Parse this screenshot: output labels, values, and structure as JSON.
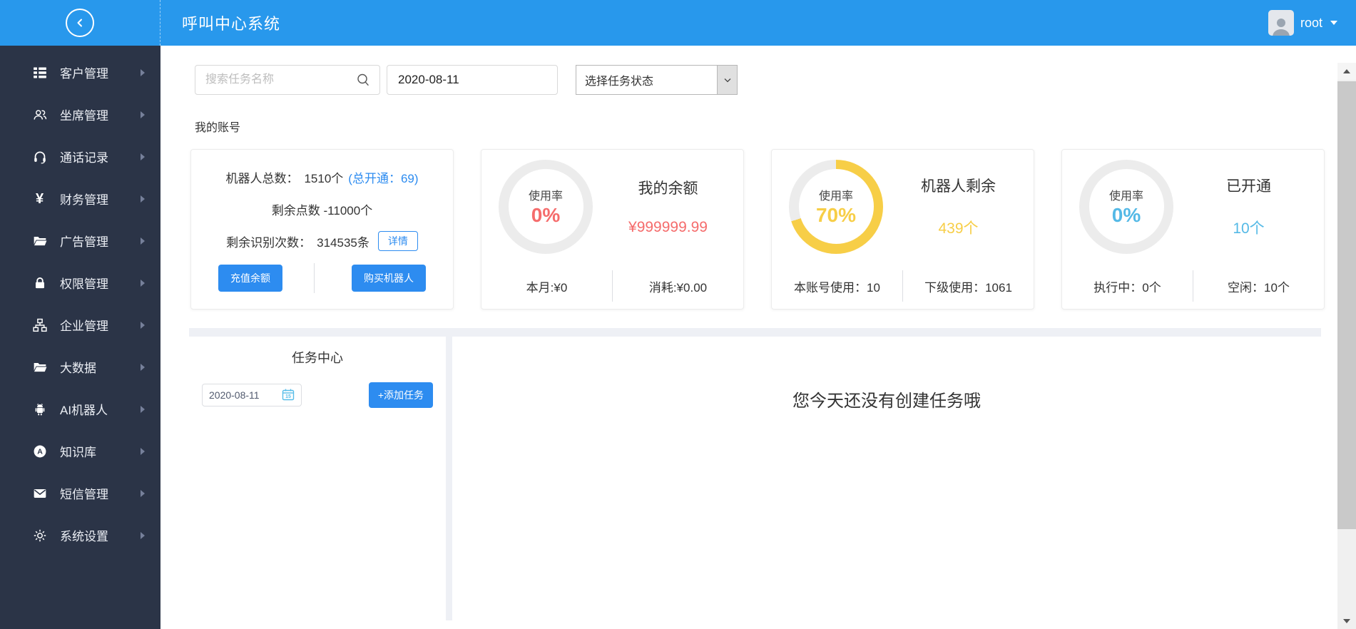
{
  "header": {
    "title": "呼叫中心系统",
    "username": "root",
    "back_icon": "chevron-left-circle-icon",
    "user_caret_icon": "caret-down-icon"
  },
  "sidebar": {
    "items": [
      {
        "label": "客户管理",
        "icon": "menu-grid-icon"
      },
      {
        "label": "坐席管理",
        "icon": "users-icon"
      },
      {
        "label": "通话记录",
        "icon": "headset-icon"
      },
      {
        "label": "财务管理",
        "icon": "yen-icon"
      },
      {
        "label": "广告管理",
        "icon": "folder-icon"
      },
      {
        "label": "权限管理",
        "icon": "lock-icon"
      },
      {
        "label": "企业管理",
        "icon": "sitemap-icon"
      },
      {
        "label": "大数据",
        "icon": "folder-icon"
      },
      {
        "label": "AI机器人",
        "icon": "robot-icon"
      },
      {
        "label": "知识库",
        "icon": "knowledge-circle-a-icon"
      },
      {
        "label": "短信管理",
        "icon": "mail-icon"
      },
      {
        "label": "系统设置",
        "icon": "gear-icon"
      }
    ]
  },
  "filters": {
    "search_placeholder": "搜索任务名称",
    "search_icon": "magnifier-icon",
    "date_value": "2020-08-11",
    "status_selected": "选择任务状态"
  },
  "account": {
    "section_title": "我的账号",
    "summary_card": {
      "robots_label": "机器人总数：",
      "robots_value": "1510个",
      "robots_link": "(总开通：69)",
      "points_text": "剩余点数 -11000个",
      "recognition_label": "剩余识别次数：",
      "recognition_value": "314535条",
      "detail_button": "详情",
      "recharge_button": "充值余额",
      "buy_button": "购买机器人"
    },
    "gauge_cards": [
      {
        "gauge_label": "使用率",
        "percent": 0,
        "percent_text": "0%",
        "accent": "#f56c6c",
        "title": "我的余额",
        "value": "¥999999.99",
        "foot_left": "本月:¥0",
        "foot_right": "消耗:¥0.00"
      },
      {
        "gauge_label": "使用率",
        "percent": 70,
        "percent_text": "70%",
        "accent": "#f7ce47",
        "title": "机器人剩余",
        "value": "439个",
        "foot_left": "本账号使用：10",
        "foot_right": "下级使用：1061"
      },
      {
        "gauge_label": "使用率",
        "percent": 0,
        "percent_text": "0%",
        "accent": "#54b9e6",
        "title": "已开通",
        "value": "10个",
        "foot_left": "执行中：0个",
        "foot_right": "空闲：10个"
      }
    ]
  },
  "task_center": {
    "title": "任务中心",
    "date_value": "2020-08-11",
    "calendar_icon_day": "15",
    "add_button": "+添加任务",
    "empty_message": "您今天还没有创建任务哦"
  },
  "colors": {
    "header_bg": "#2898ec",
    "sidebar_bg": "#2b3447",
    "primary_button": "#2d8cf0",
    "danger": "#f56c6c",
    "warning": "#f7ce47",
    "info": "#54b9e6",
    "section_bg": "#eef0f5"
  }
}
